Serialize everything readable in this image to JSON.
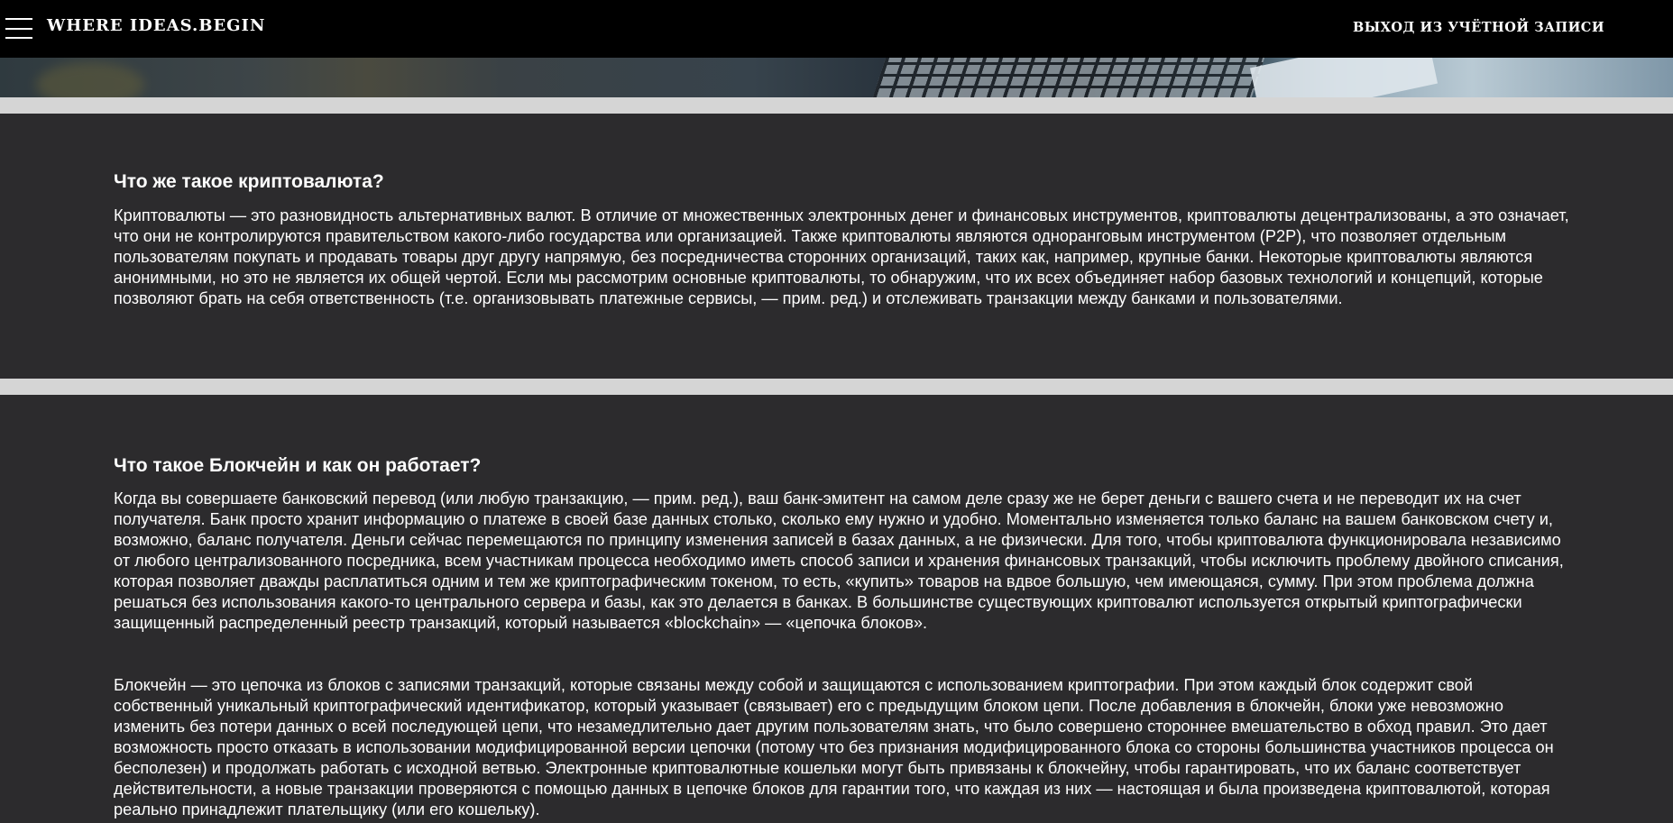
{
  "header": {
    "brand": "WHERE IDEAS.BEGIN",
    "logout_label": "ВЫХОД ИЗ УЧЁТНОЙ ЗАПИСИ",
    "menu_icon": "hamburger-menu-icon"
  },
  "sections": [
    {
      "title": "Что же такое криптовалюта?",
      "paragraphs": [
        "Криптовалюты — это разновидность альтернативных валют. В отличие от множественных электронных денег и финансовых инструментов, криптовалюты децентрализованы, а это означает, что они не контролируются правительством какого-либо государства или организацией. Также криптовалюты являются одноранговым инструментом (P2P), что позволяет отдельным пользователям покупать и продавать товары друг другу напрямую, без посредничества сторонних организаций, таких как, например, крупные банки. Некоторые криптовалюты являются анонимными, но это не является их общей чертой. Если мы рассмотрим основные криптовалюты, то обнаружим, что их всех объединяет набор базовых технологий и концепций, которые позволяют брать на себя ответственность (т.е. организовывать платежные сервисы, — прим. ред.) и отслеживать транзакции между банками и пользователями."
      ]
    },
    {
      "title": "Что такое Блокчейн и как он работает?",
      "paragraphs": [
        "Когда вы совершаете банковский перевод (или любую транзакцию, — прим. ред.), ваш банк-эмитент на самом деле сразу же не берет деньги с вашего счета и не переводит их на счет получателя. Банк просто хранит информацию о платеже в своей базе данных столько, сколько ему нужно и удобно. Моментально изменяется только баланс на вашем банковском счету и, возможно, баланс получателя. Деньги сейчас перемещаются по принципу изменения записей в базах данных, а не физически. Для того, чтобы криптовалюта функционировала независимо от любого централизованного посредника, всем участникам процесса необходимо иметь способ записи и хранения финансовых транзакций, чтобы исключить проблему двойного списания, которая позволяет дважды расплатиться одним и тем же криптографическим токеном, то есть, «купить» товаров на вдвое большую, чем имеющаяся, сумму. При этом проблема должна решаться без использования какого-то центрального сервера и базы, как это делается в банках. В большинстве существующих криптовалют используется открытый криптографически защищенный распределенный реестр транзакций, который называется «blockchain» — «цепочка блоков».",
        "Блокчейн — это цепочка из блоков с записями транзакций, которые связаны между собой и защищаются с использованием криптографии. При этом каждый блок содержит свой собственный уникальный криптографический идентификатор, который указывает (связывает) его с предыдущим блоком цепи. После добавления в блокчейн, блоки уже невозможно изменить без потери данных о всей последующей цепи, что незамедлительно дает другим пользователям знать, что было совершено стороннее вмешательство в обход правил. Это дает возможность просто отказать в использовании модифицированной версии цепочки (потому что без признания модифицированного блока со стороны большинства участников процесса он бесполезен) и продолжать работать с исходной ветвью. Электронные криптовалютные кошельки могут быть привязаны к блокчейну, чтобы гарантировать, что их баланс соответствует действительности, а новые транзакции проверяются с помощью данных в цепочке блоков для гарантии того, что каждая из них — настоящая и была произведена криптовалютой, которая реально принадлежит плательщику (или его кошельку)."
      ]
    }
  ]
}
